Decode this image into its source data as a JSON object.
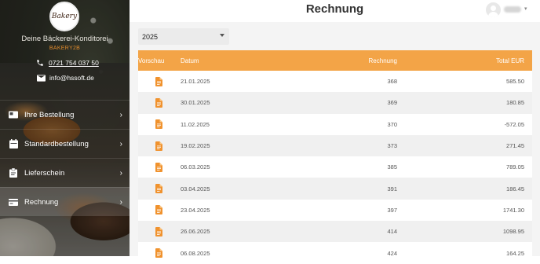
{
  "sidebar": {
    "logo_text": "Bakery",
    "tagline": "Deine Bäckerei-Konditorei",
    "brand": "BAKERY2B",
    "phone": "0721 754 037 50",
    "email": "info@hssoft.de",
    "nav": [
      {
        "label": "Ihre Bestellung",
        "icon": "cart-icon"
      },
      {
        "label": "Standardbestellung",
        "icon": "calendar-icon"
      },
      {
        "label": "Lieferschein",
        "icon": "clipboard-icon"
      },
      {
        "label": "Rechnung",
        "icon": "card-icon",
        "active": true
      }
    ]
  },
  "header": {
    "title": "Rechnung"
  },
  "filter": {
    "year": "2025"
  },
  "table": {
    "columns": [
      "Vorschau",
      "Datum",
      "Rechnung",
      "Total EUR"
    ],
    "rows": [
      {
        "datum": "21.01.2025",
        "rechnung": "368",
        "total": "585.50"
      },
      {
        "datum": "30.01.2025",
        "rechnung": "369",
        "total": "180.85"
      },
      {
        "datum": "11.02.2025",
        "rechnung": "370",
        "total": "-572.05"
      },
      {
        "datum": "19.02.2025",
        "rechnung": "373",
        "total": "271.45"
      },
      {
        "datum": "06.03.2025",
        "rechnung": "385",
        "total": "789.05"
      },
      {
        "datum": "03.04.2025",
        "rechnung": "391",
        "total": "186.45"
      },
      {
        "datum": "23.04.2025",
        "rechnung": "397",
        "total": "1741.30"
      },
      {
        "datum": "26.06.2025",
        "rechnung": "414",
        "total": "1098.95"
      },
      {
        "datum": "06.08.2025",
        "rechnung": "424",
        "total": "164.25"
      }
    ]
  },
  "colors": {
    "accent": "#f3a447",
    "brand": "#e08a2c",
    "icon": "#f0922e"
  }
}
